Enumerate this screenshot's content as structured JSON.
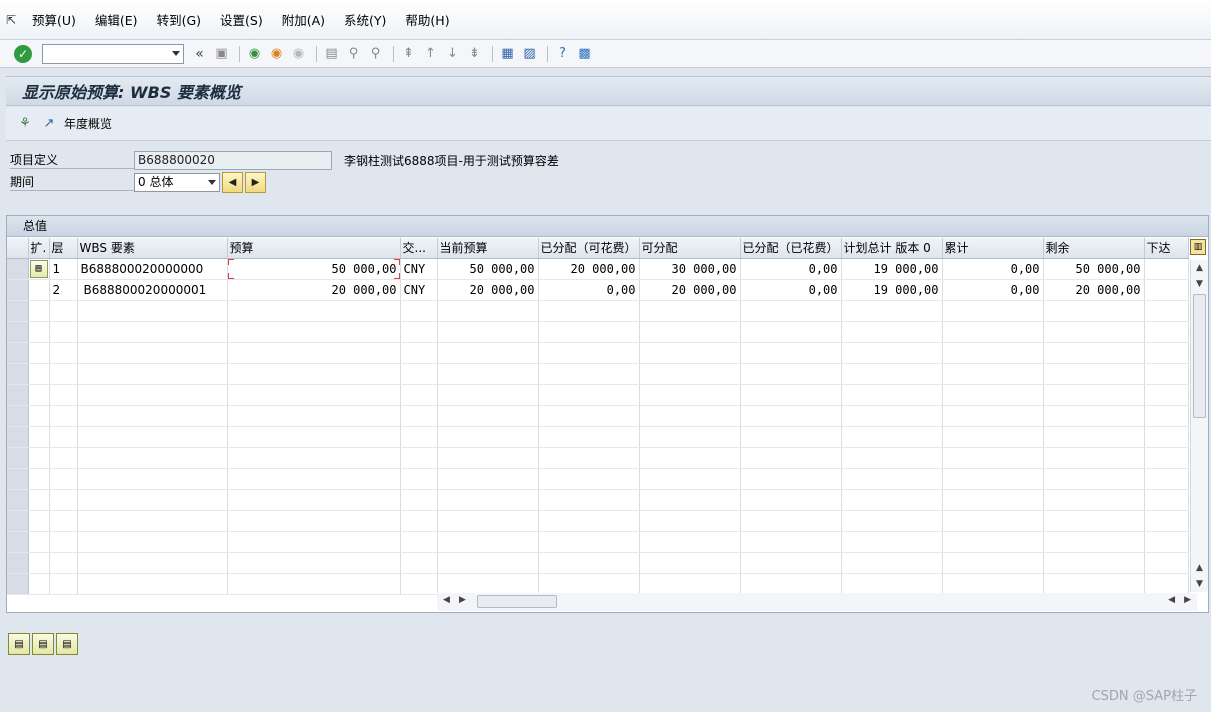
{
  "menu": {
    "items": [
      "预算(U)",
      "编辑(E)",
      "转到(G)",
      "设置(S)",
      "附加(A)",
      "系统(Y)",
      "帮助(H)"
    ]
  },
  "toolbar": {
    "command_field": "",
    "nav_back_label": "«"
  },
  "title": "显示原始预算: WBS 要素概览",
  "app_toolbar": {
    "year_overview_label": "年度概览"
  },
  "form": {
    "project_label": "项目定义",
    "project_value": "B688800020",
    "project_description": "李钢柱测试6888项目-用于测试预算容差",
    "period_label": "期间",
    "period_value": "0 总体"
  },
  "grid": {
    "title": "总值",
    "columns": [
      "扩.",
      "层",
      "WBS 要素",
      "预算",
      "交...",
      "当前预算",
      "已分配（可花费）",
      "可分配",
      "已分配（已花费）",
      "计划总计 版本 0",
      "累计",
      "剩余",
      "下达"
    ],
    "rows": [
      {
        "expand": "",
        "level": "1",
        "wbs": "B688800020000000",
        "budget": "50 000,00",
        "currency": "CNY",
        "current_budget": "50 000,00",
        "assigned_spendable": "20 000,00",
        "distributable": "30 000,00",
        "assigned_spent": "0,00",
        "planned_total": "19 000,00",
        "cumulative": "0,00",
        "remaining": "50 000,00",
        "released": ""
      },
      {
        "expand": "",
        "level": "2",
        "wbs": "B688800020000001",
        "budget": "20 000,00",
        "currency": "CNY",
        "current_budget": "20 000,00",
        "assigned_spendable": "0,00",
        "distributable": "20 000,00",
        "assigned_spent": "0,00",
        "planned_total": "19 000,00",
        "cumulative": "0,00",
        "remaining": "20 000,00",
        "released": ""
      }
    ]
  },
  "watermark": "CSDN @SAP柱子"
}
